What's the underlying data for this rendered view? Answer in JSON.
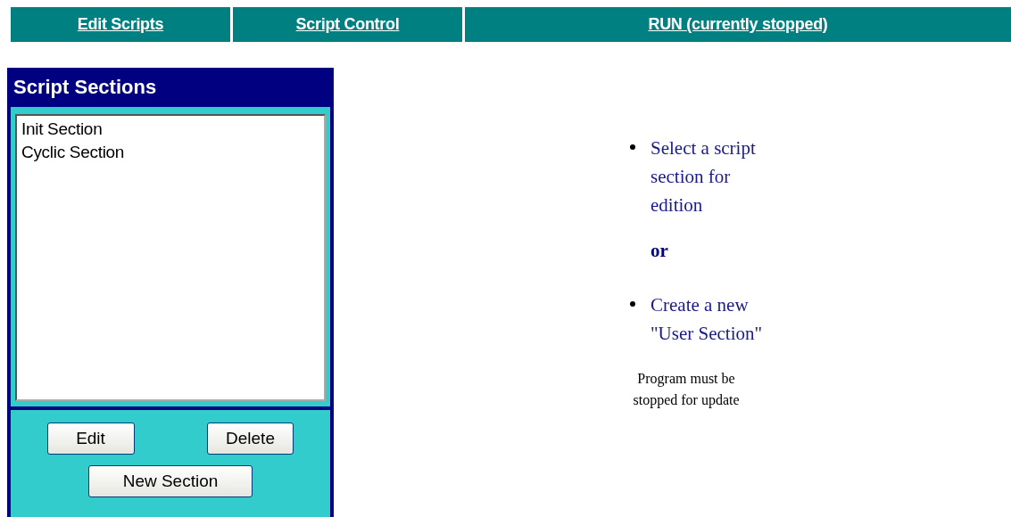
{
  "nav_tabs": [
    {
      "label": "Edit Scripts"
    },
    {
      "label": "Script Control"
    },
    {
      "label": "RUN (currently stopped)"
    }
  ],
  "script_sections": {
    "title": "Script Sections",
    "items": [
      {
        "label": "Init Section",
        "selected": false
      },
      {
        "label": "Cyclic Section",
        "selected": false
      }
    ],
    "buttons": [
      "Edit",
      "Delete",
      "New Section"
    ]
  },
  "instructions": {
    "items": [
      {
        "kind": "bullet",
        "text": "Select a script section for edition"
      },
      {
        "kind": "separator",
        "text": "or"
      },
      {
        "kind": "bullet",
        "text": "Create a new \"User Section\""
      }
    ],
    "note": "Program must be stopped for update"
  }
}
